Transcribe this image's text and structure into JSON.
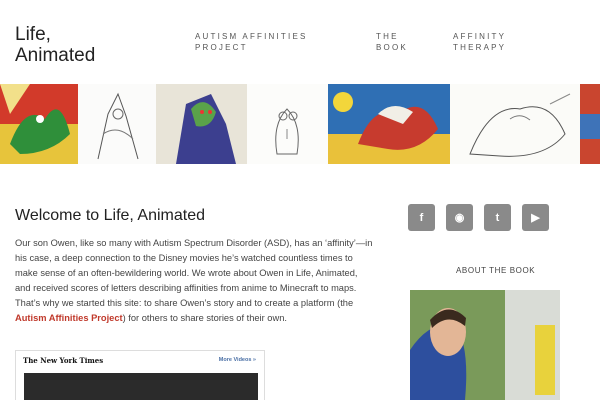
{
  "site": {
    "title": "Life, Animated"
  },
  "nav": {
    "items": [
      {
        "label": "AUTISM AFFINITIES PROJECT"
      },
      {
        "label": "THE BOOK"
      },
      {
        "label": "AFFINITY THERAPY"
      }
    ]
  },
  "main": {
    "heading": "Welcome to Life, Animated",
    "intro_before_link": "Our son Owen, like so many with Autism Spectrum Disorder (ASD), has an ‘affinity’—in his case, a deep connection to the Disney movies he’s watched countless times to make sense of an often-bewildering world. We wrote about Owen in Life, Animated, and received scores of letters describing affinities from anime to Minecraft to maps. That’s why we started this site: to share Owen’s story and to create a platform (the ",
    "intro_link": "Autism Affinities Project",
    "intro_after_link": ") for others to share stories of their own.",
    "video": {
      "source": "The New York Times",
      "more_label": "More Videos »"
    }
  },
  "sidebar": {
    "social": [
      {
        "icon": "facebook-icon",
        "glyph": "f"
      },
      {
        "icon": "rss-icon",
        "glyph": "◉"
      },
      {
        "icon": "twitter-icon",
        "glyph": "t"
      },
      {
        "icon": "youtube-icon",
        "glyph": "▶"
      }
    ],
    "about_heading": "ABOUT THE BOOK"
  },
  "colors": {
    "accent_link": "#c0392b",
    "social_bg": "#8a8a8a",
    "heading": "#222222"
  }
}
